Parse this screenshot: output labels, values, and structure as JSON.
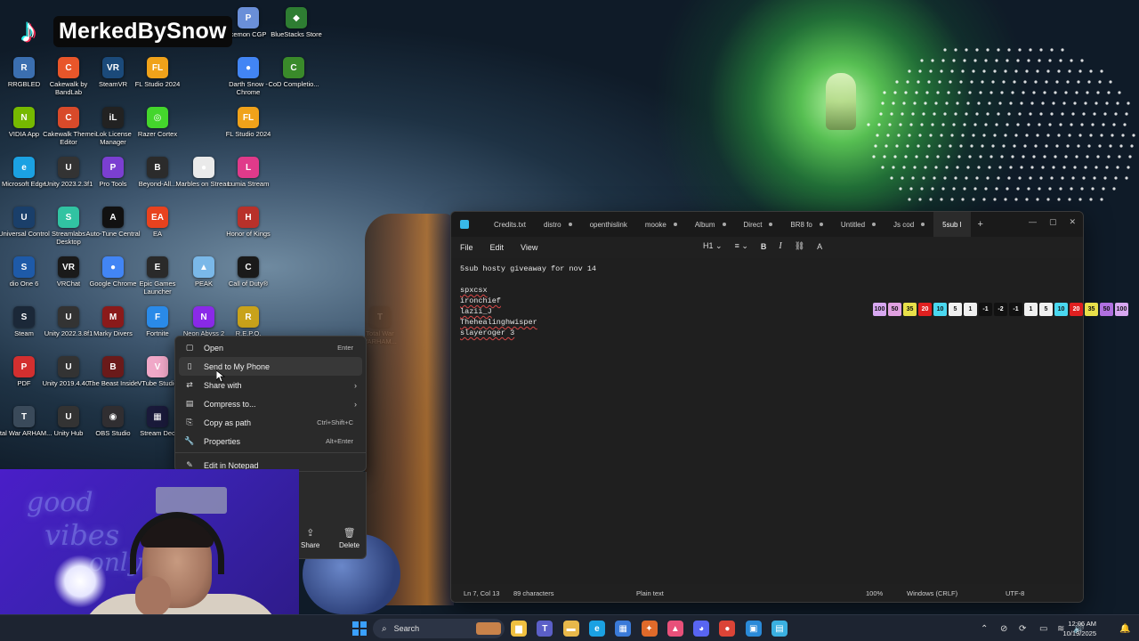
{
  "overlay": {
    "channel_name": "MerkedBySnow",
    "tiktok_glyph": "♪"
  },
  "desktop_icons": [
    {
      "label": "BlueStacks Store",
      "color": "#2e7d32",
      "glyph": "◆"
    },
    {
      "label": "kemon CGP",
      "color": "#6a8fd8",
      "glyph": "P"
    },
    {
      "label": "RRGBLED",
      "color": "#3b6fb0",
      "glyph": "R"
    },
    {
      "label": "Cakewalk by BandLab",
      "color": "#e8562a",
      "glyph": "C"
    },
    {
      "label": "SteamVR",
      "color": "#1b4a7a",
      "glyph": "VR"
    },
    {
      "label": "FL Studio 2024",
      "color": "#f0a21a",
      "glyph": "FL"
    },
    {
      "label": "Darth Snow - Chrome",
      "color": "#4285f4",
      "glyph": "●"
    },
    {
      "label": "CoD Completio...",
      "color": "#3a8a2a",
      "glyph": "C"
    },
    {
      "label": "VIDIA App",
      "color": "#76b900",
      "glyph": "N"
    },
    {
      "label": "Cakewalk Theme Editor",
      "color": "#d84a2a",
      "glyph": "C"
    },
    {
      "label": "iLok License Manager",
      "color": "#222222",
      "glyph": "iL"
    },
    {
      "label": "Razer Cortex",
      "color": "#44d62c",
      "glyph": "◎"
    },
    {
      "label": "FL Studio 2024",
      "color": "#f0a21a",
      "glyph": "FL"
    },
    {
      "label": "Microsoft Edge",
      "color": "#1ba1e2",
      "glyph": "e"
    },
    {
      "label": "Unity 2023.2.3f1",
      "color": "#333333",
      "glyph": "U"
    },
    {
      "label": "Pro Tools",
      "color": "#7b3fd1",
      "glyph": "P"
    },
    {
      "label": "Beyond-All...",
      "color": "#2b2b2b",
      "glyph": "B"
    },
    {
      "label": "Marbles on Stream",
      "color": "#eaeaea",
      "glyph": "●"
    },
    {
      "label": "Lumia Stream",
      "color": "#e03a8a",
      "glyph": "L"
    },
    {
      "label": "Universal Control",
      "color": "#1a3f6a",
      "glyph": "U"
    },
    {
      "label": "Streamlabs Desktop",
      "color": "#31c3a2",
      "glyph": "S"
    },
    {
      "label": "Auto-Tune Central",
      "color": "#111111",
      "glyph": "A"
    },
    {
      "label": "EA",
      "color": "#e8421e",
      "glyph": "EA"
    },
    {
      "label": "Honor of Kings",
      "color": "#b8312a",
      "glyph": "H"
    },
    {
      "label": "dio One 6",
      "color": "#1e5aa8",
      "glyph": "S"
    },
    {
      "label": "VRChat",
      "color": "#1a1a1a",
      "glyph": "VR"
    },
    {
      "label": "Google Chrome",
      "color": "#4285f4",
      "glyph": "●"
    },
    {
      "label": "Epic Games Launcher",
      "color": "#2a2a2a",
      "glyph": "E"
    },
    {
      "label": "PEAK",
      "color": "#7ab8e8",
      "glyph": "▲"
    },
    {
      "label": "Call of Duty®",
      "color": "#1a1a1a",
      "glyph": "C"
    },
    {
      "label": "Steam",
      "color": "#1b2838",
      "glyph": "S"
    },
    {
      "label": "Unity 2022.3.8f1",
      "color": "#333333",
      "glyph": "U"
    },
    {
      "label": "Marky Divers",
      "color": "#8a1a1a",
      "glyph": "M"
    },
    {
      "label": "Fortnite",
      "color": "#2a8ae8",
      "glyph": "F"
    },
    {
      "label": "Neon Abyss 2",
      "color": "#8a2ae8",
      "glyph": "N"
    },
    {
      "label": "R.E.P.O.",
      "color": "#c8a21a",
      "glyph": "R"
    },
    {
      "label": "Total War VARHAM...",
      "color": "#3a4a5a",
      "glyph": "T"
    },
    {
      "label": "PDF",
      "color": "#d32f2f",
      "glyph": "P"
    },
    {
      "label": "Unity 2019.4.40...",
      "color": "#333333",
      "glyph": "U"
    },
    {
      "label": "The Beast Inside",
      "color": "#6a1a1a",
      "glyph": "B"
    },
    {
      "label": "VTube Studio",
      "color": "#f0a8c8",
      "glyph": "V"
    },
    {
      "label": "otal War ARHAM...",
      "color": "#3a4a5a",
      "glyph": "T"
    },
    {
      "label": "Unity Hub",
      "color": "#333333",
      "glyph": "U"
    },
    {
      "label": "OBS Studio",
      "color": "#302e31",
      "glyph": "◉"
    },
    {
      "label": "Stream Dec",
      "color": "#1a1a3a",
      "glyph": "▦"
    }
  ],
  "notepad": {
    "tabs": [
      {
        "label": "Credits.txt",
        "dot": false,
        "active": false
      },
      {
        "label": "distro",
        "dot": true,
        "active": false
      },
      {
        "label": "openthislink",
        "dot": false,
        "active": false
      },
      {
        "label": "mooke",
        "dot": true,
        "active": false
      },
      {
        "label": "Album",
        "dot": true,
        "active": false
      },
      {
        "label": "Direct",
        "dot": true,
        "active": false
      },
      {
        "label": "BR8 fo",
        "dot": true,
        "active": false
      },
      {
        "label": "Untitled",
        "dot": true,
        "active": false
      },
      {
        "label": "Js cod",
        "dot": true,
        "active": false
      },
      {
        "label": "5sub l",
        "dot": false,
        "active": true
      }
    ],
    "menu": {
      "file": "File",
      "edit": "Edit",
      "view": "View"
    },
    "format": {
      "heading": "H1",
      "list": "≡",
      "bold": "B",
      "italic": "I",
      "link": "⛓",
      "clear": "A"
    },
    "lines": [
      {
        "text": "5sub hosty giveaway for nov 14",
        "squiggle": false
      },
      {
        "text": "",
        "squiggle": false
      },
      {
        "text": "spxcsx",
        "squiggle": true
      },
      {
        "text": "ironchief",
        "squiggle": true
      },
      {
        "text": "lazii_J",
        "squiggle": true
      },
      {
        "text": "Thehealinghwisper",
        "squiggle": true
      },
      {
        "text": "slayeroger 3",
        "squiggle": true
      }
    ],
    "status": {
      "position": "Ln 7, Col 13",
      "chars": "89 characters",
      "format": "Plain text",
      "zoom": "100%",
      "line_ending": "Windows (CRLF)",
      "encoding": "UTF-8"
    }
  },
  "context_menu": {
    "items": [
      {
        "label": "Open",
        "shortcut": "Enter",
        "icon": "open-icon",
        "glyph": "▢",
        "submenu": false,
        "hover": false
      },
      {
        "label": "Send to My Phone",
        "shortcut": "",
        "icon": "phone-icon",
        "glyph": "▯",
        "submenu": false,
        "hover": true
      },
      {
        "label": "Share with",
        "shortcut": "",
        "icon": "share-with-icon",
        "glyph": "⇄",
        "submenu": true,
        "hover": false
      },
      {
        "label": "Compress to...",
        "shortcut": "",
        "icon": "compress-icon",
        "glyph": "▤",
        "submenu": true,
        "hover": false
      },
      {
        "label": "Copy as path",
        "shortcut": "Ctrl+Shift+C",
        "icon": "copy-path-icon",
        "glyph": "⎘",
        "submenu": false,
        "hover": false
      },
      {
        "label": "Properties",
        "shortcut": "Alt+Enter",
        "icon": "properties-icon",
        "glyph": "🔧",
        "submenu": false,
        "hover": false
      },
      {
        "label": "Edit in Notepad",
        "shortcut": "",
        "icon": "notepad-icon",
        "glyph": "✎",
        "submenu": false,
        "hover": false
      }
    ],
    "actions": {
      "share": "Share",
      "delete": "Delete"
    }
  },
  "badges": [
    {
      "t": "100",
      "c": "#d7a7f0"
    },
    {
      "t": "50",
      "c": "#e0a0e0"
    },
    {
      "t": "35",
      "c": "#e8e04a"
    },
    {
      "t": "20",
      "c": "#e02020"
    },
    {
      "t": "10",
      "c": "#4ad8f0"
    },
    {
      "t": "5",
      "c": "#f0f0f0"
    },
    {
      "t": "1",
      "c": "#f0f0f0"
    },
    {
      "t": "-1",
      "c": "#111111"
    },
    {
      "t": "-2",
      "c": "#111111"
    },
    {
      "t": "-1",
      "c": "#111111"
    },
    {
      "t": "1",
      "c": "#f0f0f0"
    },
    {
      "t": "5",
      "c": "#f0f0f0"
    },
    {
      "t": "10",
      "c": "#4ad8f0"
    },
    {
      "t": "20",
      "c": "#e02020"
    },
    {
      "t": "35",
      "c": "#e8e04a"
    },
    {
      "t": "50",
      "c": "#b070e0"
    },
    {
      "t": "100",
      "c": "#d7a7f0"
    }
  ],
  "camera": {
    "neon_1": "good",
    "neon_2": "vibes",
    "neon_3": "only"
  },
  "taskbar": {
    "search_placeholder": "Search",
    "time": "12:06 AM",
    "date": "10/19/2025",
    "apps": [
      {
        "name": "file-explorer",
        "color": "#f0c040",
        "glyph": "▆"
      },
      {
        "name": "teams",
        "color": "#5b5fc7",
        "glyph": "T"
      },
      {
        "name": "folder",
        "color": "#e8b84a",
        "glyph": "▬"
      },
      {
        "name": "edge",
        "color": "#1ba1e2",
        "glyph": "e"
      },
      {
        "name": "store",
        "color": "#3a7ad8",
        "glyph": "▦"
      },
      {
        "name": "copilot",
        "color": "#e06a2a",
        "glyph": "✦"
      },
      {
        "name": "photos",
        "color": "#e8507a",
        "glyph": "▲"
      },
      {
        "name": "discord",
        "color": "#5865f2",
        "glyph": "◕"
      },
      {
        "name": "chrome",
        "color": "#db4437",
        "glyph": "●"
      },
      {
        "name": "photos-viewer",
        "color": "#2a8ad8",
        "glyph": "▣"
      },
      {
        "name": "notepad",
        "color": "#3ab0e0",
        "glyph": "▤"
      }
    ]
  }
}
